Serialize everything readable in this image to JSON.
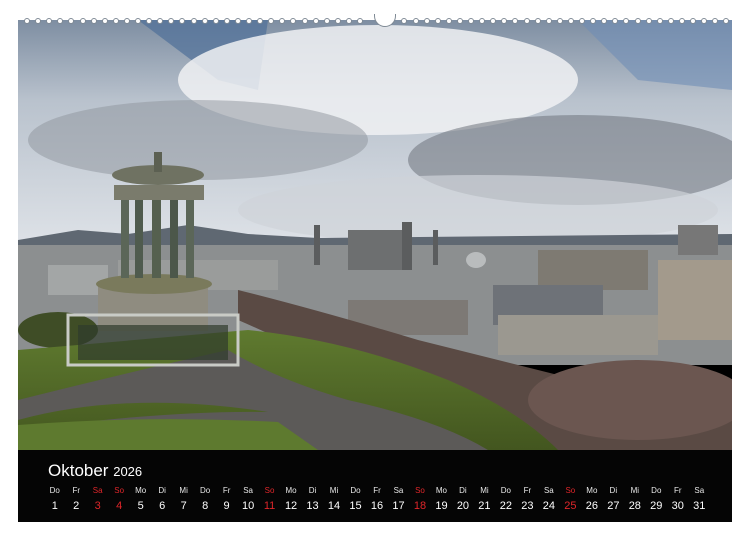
{
  "calendar": {
    "month": "Oktober",
    "year": "2026",
    "days": [
      {
        "wd": "Do",
        "d": "1"
      },
      {
        "wd": "Fr",
        "d": "2"
      },
      {
        "wd": "Sa",
        "d": "3",
        "red": true
      },
      {
        "wd": "So",
        "d": "4",
        "red": true
      },
      {
        "wd": "Mo",
        "d": "5"
      },
      {
        "wd": "Di",
        "d": "6"
      },
      {
        "wd": "Mi",
        "d": "7"
      },
      {
        "wd": "Do",
        "d": "8"
      },
      {
        "wd": "Fr",
        "d": "9"
      },
      {
        "wd": "Sa",
        "d": "10"
      },
      {
        "wd": "So",
        "d": "11",
        "red": true
      },
      {
        "wd": "Mo",
        "d": "12"
      },
      {
        "wd": "Di",
        "d": "13"
      },
      {
        "wd": "Mi",
        "d": "14"
      },
      {
        "wd": "Do",
        "d": "15"
      },
      {
        "wd": "Fr",
        "d": "16"
      },
      {
        "wd": "Sa",
        "d": "17"
      },
      {
        "wd": "So",
        "d": "18",
        "red": true
      },
      {
        "wd": "Mo",
        "d": "19"
      },
      {
        "wd": "Di",
        "d": "20"
      },
      {
        "wd": "Mi",
        "d": "21"
      },
      {
        "wd": "Do",
        "d": "22"
      },
      {
        "wd": "Fr",
        "d": "23"
      },
      {
        "wd": "Sa",
        "d": "24"
      },
      {
        "wd": "So",
        "d": "25",
        "red": true
      },
      {
        "wd": "Mo",
        "d": "26"
      },
      {
        "wd": "Di",
        "d": "27"
      },
      {
        "wd": "Mi",
        "d": "28"
      },
      {
        "wd": "Do",
        "d": "29"
      },
      {
        "wd": "Fr",
        "d": "30"
      },
      {
        "wd": "Sa",
        "d": "31"
      }
    ]
  },
  "colors": {
    "strip": "#050505",
    "holiday": "#e0262a",
    "text": "#ffffff"
  }
}
